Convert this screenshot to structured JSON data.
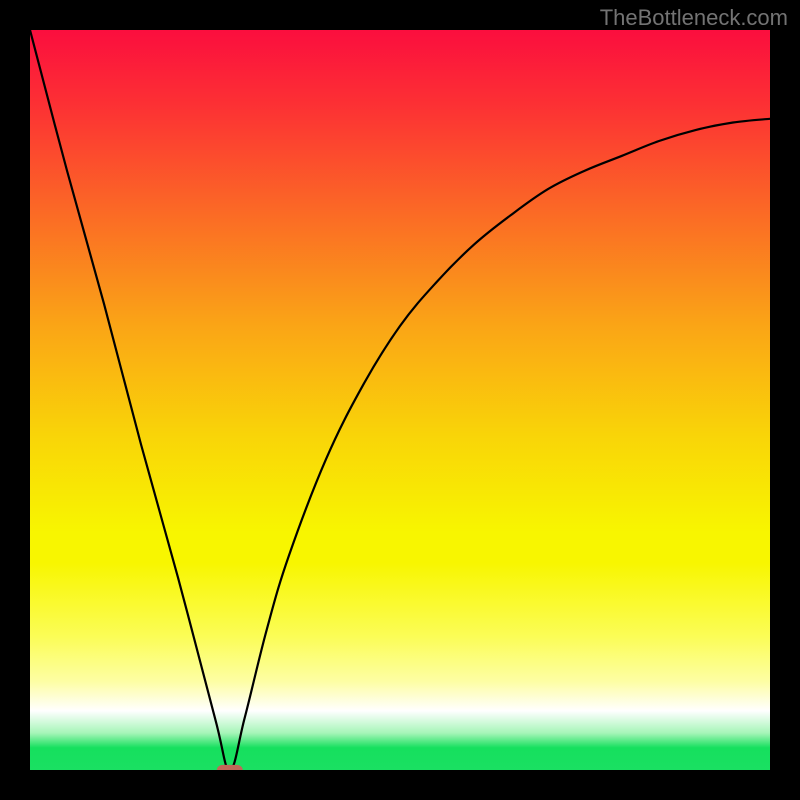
{
  "watermark": "TheBottleneck.com",
  "chart_data": {
    "type": "line",
    "title": "",
    "xlabel": "",
    "ylabel": "",
    "xlim": [
      0,
      100
    ],
    "ylim": [
      0,
      100
    ],
    "grid": false,
    "series": [
      {
        "name": "bottleneck-curve",
        "x_min_at": 27,
        "points": [
          {
            "x": 0,
            "y": 100
          },
          {
            "x": 5,
            "y": 81
          },
          {
            "x": 10,
            "y": 63
          },
          {
            "x": 15,
            "y": 44
          },
          {
            "x": 20,
            "y": 26
          },
          {
            "x": 25,
            "y": 7
          },
          {
            "x": 27,
            "y": 0
          },
          {
            "x": 29,
            "y": 7
          },
          {
            "x": 32,
            "y": 19
          },
          {
            "x": 35,
            "y": 29
          },
          {
            "x": 40,
            "y": 42
          },
          {
            "x": 45,
            "y": 52
          },
          {
            "x": 50,
            "y": 60
          },
          {
            "x": 55,
            "y": 66
          },
          {
            "x": 60,
            "y": 71
          },
          {
            "x": 65,
            "y": 75
          },
          {
            "x": 70,
            "y": 78.5
          },
          {
            "x": 75,
            "y": 81
          },
          {
            "x": 80,
            "y": 83
          },
          {
            "x": 85,
            "y": 85
          },
          {
            "x": 90,
            "y": 86.5
          },
          {
            "x": 95,
            "y": 87.5
          },
          {
            "x": 100,
            "y": 88
          }
        ]
      }
    ],
    "gradient_stops": [
      {
        "pos": 0.0,
        "color": "#fb0e3e"
      },
      {
        "pos": 0.1,
        "color": "#fc3034"
      },
      {
        "pos": 0.25,
        "color": "#fb6b25"
      },
      {
        "pos": 0.4,
        "color": "#faa516"
      },
      {
        "pos": 0.55,
        "color": "#f9d508"
      },
      {
        "pos": 0.68,
        "color": "#f8f600"
      },
      {
        "pos": 0.72,
        "color": "#f8f600"
      },
      {
        "pos": 0.82,
        "color": "#fbfd57"
      },
      {
        "pos": 0.88,
        "color": "#fdfea3"
      },
      {
        "pos": 0.92,
        "color": "#ffffff"
      },
      {
        "pos": 0.95,
        "color": "#a6f5b8"
      },
      {
        "pos": 0.97,
        "color": "#16e05e"
      },
      {
        "pos": 1.0,
        "color": "#1ae062"
      }
    ],
    "marker": {
      "shape": "rounded-rect",
      "cx": 27,
      "cy": 0,
      "w": 3.5,
      "h": 1.4,
      "rx": 0.8,
      "fill": "#c06858"
    }
  }
}
